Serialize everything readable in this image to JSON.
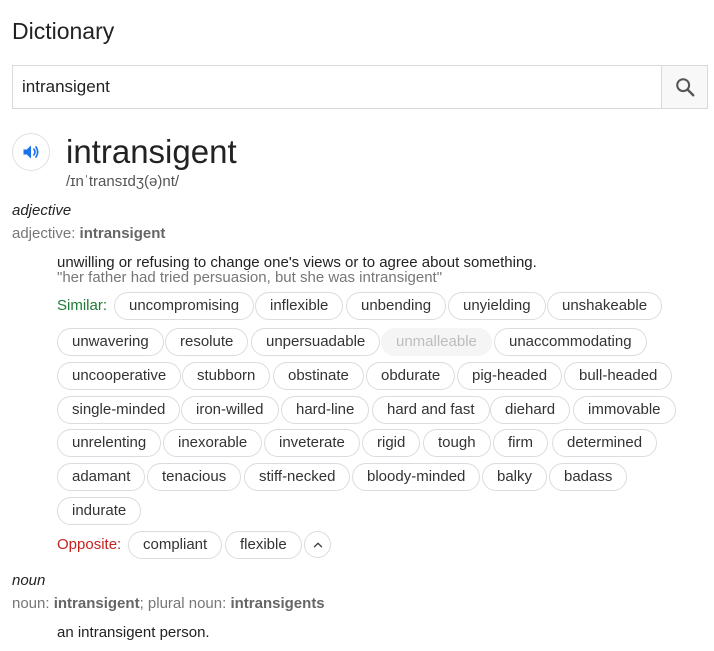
{
  "header": {
    "title": "Dictionary"
  },
  "search": {
    "value": "intransigent"
  },
  "entry": {
    "word": "intransigent",
    "phonetic": "/ɪnˈtransɪdʒ(ə)nt/"
  },
  "adjective": {
    "pos": "adjective",
    "pos_prefix": "adjective: ",
    "pos_word": "intransigent",
    "definition": "unwilling or refusing to change one's views or to agree about something.",
    "example": "\"her father had tried persuasion, but she was intransigent\"",
    "similar_label": "Similar:",
    "opposite_label": "Opposite:",
    "similar": [
      "uncompromising",
      "inflexible",
      "unbending",
      "unyielding",
      "unshakeable",
      "unwavering",
      "resolute",
      "unpersuadable",
      "unmalleable",
      "unaccommodating",
      "uncooperative",
      "stubborn",
      "obstinate",
      "obdurate",
      "pig-headed",
      "bull-headed",
      "single-minded",
      "iron-willed",
      "hard-line",
      "hard and fast",
      "diehard",
      "immovable",
      "unrelenting",
      "inexorable",
      "inveterate",
      "rigid",
      "tough",
      "firm",
      "determined",
      "adamant",
      "tenacious",
      "stiff-necked",
      "bloody-minded",
      "balky",
      "badass",
      "indurate"
    ],
    "opposite": [
      "compliant",
      "flexible"
    ]
  },
  "noun": {
    "pos": "noun",
    "pos_prefix": "noun: ",
    "pos_word": "intransigent",
    "plural_prefix": "; plural noun: ",
    "plural_word": "intransigents",
    "definition": "an intransigent person."
  },
  "colors": {
    "similar_label": "#1e7b34",
    "opposite_label": "#c5221f",
    "speaker_icon": "#1a73e8"
  },
  "icons": {
    "search": "search-icon",
    "speaker": "speaker-icon",
    "collapse": "chevron-up-icon"
  }
}
